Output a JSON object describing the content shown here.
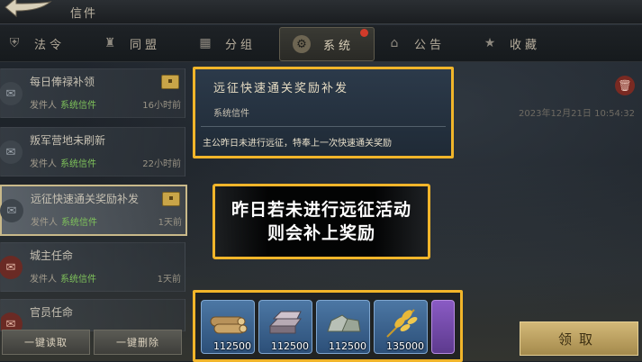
{
  "header": {
    "title": "信件"
  },
  "tabs": [
    {
      "label": "法令",
      "icon": "shield-icon"
    },
    {
      "label": "同盟",
      "icon": "castle-icon"
    },
    {
      "label": "分组",
      "icon": "grid-icon"
    },
    {
      "label": "系统",
      "icon": "gear-icon",
      "active": true,
      "badge": true
    },
    {
      "label": "公告",
      "icon": "hall-icon"
    },
    {
      "label": "收藏",
      "icon": "star-icon"
    }
  ],
  "mails": [
    {
      "title": "每日俸禄补领",
      "sender_prefix": "发件人",
      "sender": "系统信件",
      "time": "16小时前",
      "attachment": true
    },
    {
      "title": "叛军营地未刷新",
      "sender_prefix": "发件人",
      "sender": "系统信件",
      "time": "22小时前",
      "attachment": false
    },
    {
      "title": "远征快速通关奖励补发",
      "sender_prefix": "发件人",
      "sender": "系统信件",
      "time": "1天前",
      "attachment": true,
      "selected": true
    },
    {
      "title": "城主任命",
      "sender_prefix": "发件人",
      "sender": "系统信件",
      "time": "1天前",
      "attachment": false
    },
    {
      "title": "官员任命",
      "sender_prefix": "",
      "sender": "",
      "time": "",
      "attachment": false
    }
  ],
  "list_buttons": {
    "read_all": "一键读取",
    "delete_all": "一键删除"
  },
  "detail": {
    "title": "远征快速通关奖励补发",
    "from": "系统信件",
    "date": "2023年12月21日 10:54:32",
    "body": "主公昨日未进行远征，特奉上一次快速通关奖励"
  },
  "banner": {
    "line1": "昨日若未进行远征活动",
    "line2": "则会补上奖励"
  },
  "rewards": [
    {
      "item": "wood",
      "qty": "112500"
    },
    {
      "item": "iron",
      "qty": "112500"
    },
    {
      "item": "stone",
      "qty": "112500"
    },
    {
      "item": "grain",
      "qty": "135000"
    }
  ],
  "claim_label": "领取",
  "colors": {
    "highlight": "#f1b52a",
    "sender_green": "#7fc35b",
    "claim": "#c9ae6b"
  }
}
